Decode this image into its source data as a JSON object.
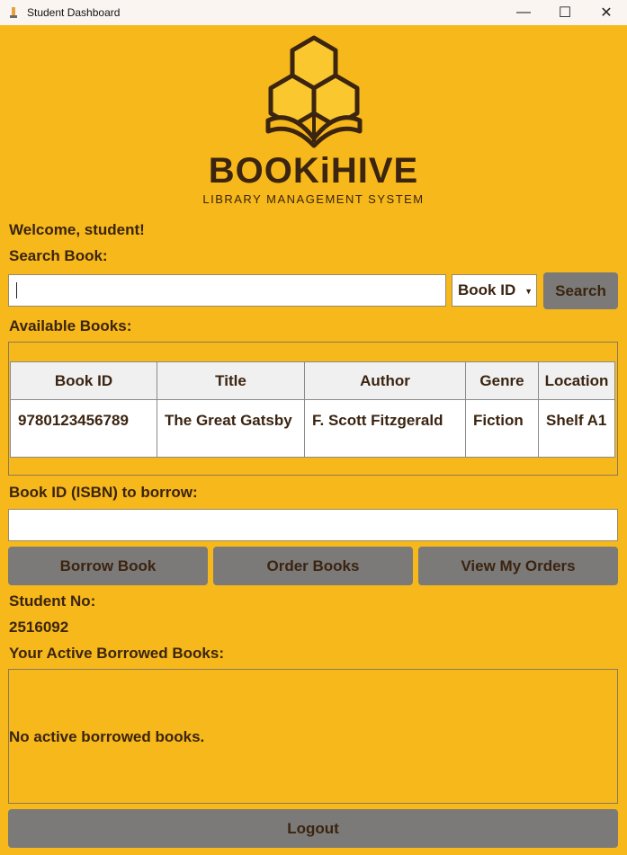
{
  "window": {
    "title": "Student Dashboard",
    "minimize_glyph": "—",
    "maximize_glyph": "☐",
    "close_glyph": "✕"
  },
  "brand": {
    "name": "BOOKiHIVE",
    "tagline": "LIBRARY MANAGEMENT SYSTEM"
  },
  "welcome": "Welcome, student!",
  "search": {
    "label": "Search Book:",
    "value": "",
    "filter_selected": "Book ID",
    "button_label": "Search"
  },
  "available": {
    "label": "Available Books:",
    "columns": [
      "Book ID",
      "Title",
      "Author",
      "Genre",
      "Location"
    ],
    "rows": [
      [
        "9780123456789",
        "The Great Gatsby",
        "F. Scott Fitzgerald",
        "Fiction",
        "Shelf A1"
      ]
    ]
  },
  "borrow": {
    "label": "Book ID (ISBN) to borrow:",
    "value": ""
  },
  "actions": {
    "borrow_label": "Borrow Book",
    "order_label": "Order Books",
    "view_orders_label": "View My Orders"
  },
  "student": {
    "no_label": "Student No:",
    "no_value": "2516092"
  },
  "borrowed": {
    "label": "Your Active Borrowed Books:",
    "empty_message": "No active borrowed books."
  },
  "logout_label": "Logout",
  "colors": {
    "background": "#f6b81a",
    "text": "#3b2410",
    "button": "#7b7a78"
  }
}
